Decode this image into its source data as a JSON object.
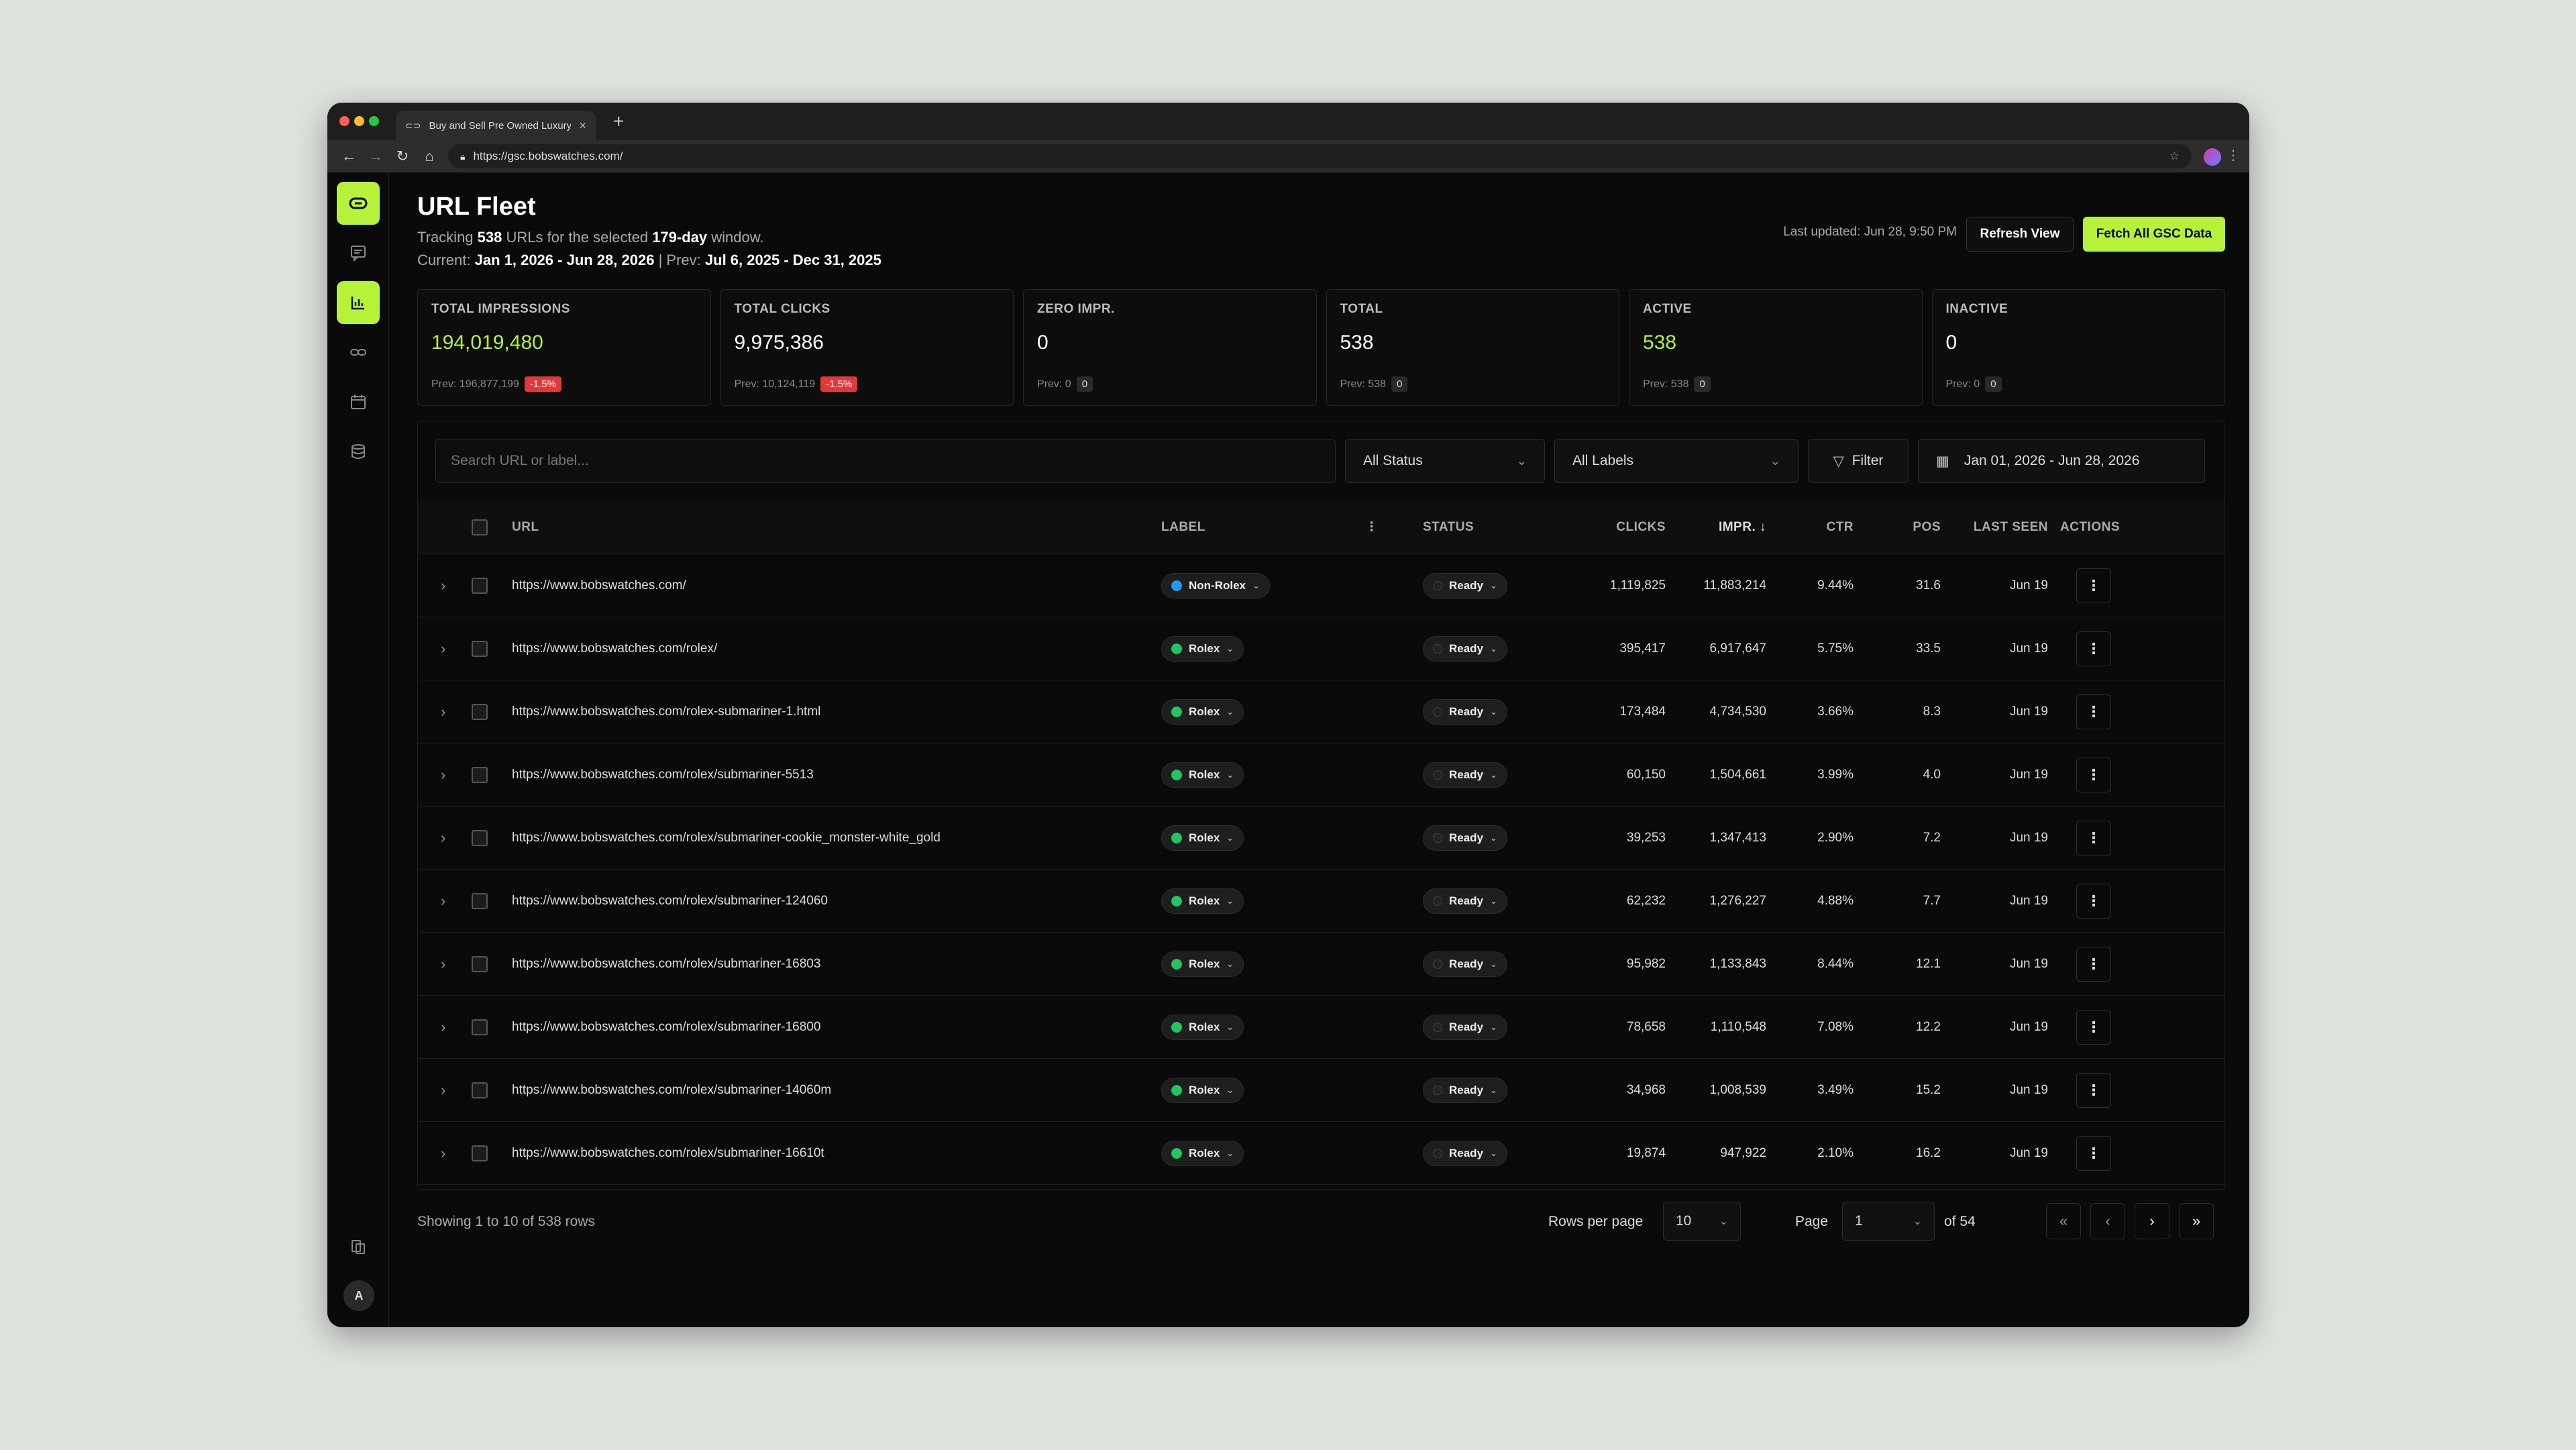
{
  "browser": {
    "tab_title": "Buy and Sell Pre Owned Luxury",
    "new_tab": "+",
    "url": "https://gsc.bobswatches.com/"
  },
  "header": {
    "title": "URL Fleet",
    "tracking_prefix": "Tracking",
    "tracking_count": "538",
    "tracking_mid": "URLs for the selected",
    "tracking_window": "179-day",
    "tracking_suffix": "window.",
    "current_label": "Current:",
    "current_range": "Jan 1, 2026 - Jun 28, 2026",
    "sep": "|",
    "prev_label": "Prev:",
    "prev_range": "Jul 6, 2025 - Dec 31, 2025",
    "last_updated": "Last updated: Jun 28, 9:50 PM",
    "refresh_label": "Refresh View",
    "fetch_label": "Fetch All GSC Data"
  },
  "stats": [
    {
      "label": "TOTAL IMPRESSIONS",
      "value": "194,019,480",
      "prev": "Prev: 196,877,199",
      "delta": "-1.5%"
    },
    {
      "label": "TOTAL CLICKS",
      "value": "9,975,386",
      "prev": "Prev: 10,124,119",
      "delta": "-1.5%"
    },
    {
      "label": "ZERO IMPR.",
      "value": "0",
      "prev": "Prev: 0",
      "delta": "0"
    },
    {
      "label": "TOTAL",
      "value": "538",
      "prev": "Prev: 538",
      "delta": "0"
    },
    {
      "label": "ACTIVE",
      "value": "538",
      "prev": "Prev: 538",
      "delta": "0"
    },
    {
      "label": "INACTIVE",
      "value": "0",
      "prev": "Prev: 0",
      "delta": "0"
    }
  ],
  "filters": {
    "search_placeholder": "Search URL or label...",
    "status": "All Status",
    "labels": "All Labels",
    "filter": "Filter",
    "date_range": "Jan 01, 2026 - Jun 28, 2026"
  },
  "columns": {
    "url": "URL",
    "label": "LABEL",
    "status": "STATUS",
    "clicks": "CLICKS",
    "impr": "IMPR. ↓",
    "ctr": "CTR",
    "pos": "POS",
    "last_seen": "LAST SEEN",
    "actions": "ACTIONS"
  },
  "rows": [
    {
      "url": "https://www.bobswatches.com/",
      "label": "Non-Rolex",
      "status": "Ready",
      "clicks": "1,119,825",
      "impr": "11,883,214",
      "ctr": "9.44%",
      "pos": "31.6",
      "last_seen": "Jun 19"
    },
    {
      "url": "https://www.bobswatches.com/rolex/",
      "label": "Rolex",
      "status": "Ready",
      "clicks": "395,417",
      "impr": "6,917,647",
      "ctr": "5.75%",
      "pos": "33.5",
      "last_seen": "Jun 19"
    },
    {
      "url": "https://www.bobswatches.com/rolex-submariner-1.html",
      "label": "Rolex",
      "status": "Ready",
      "clicks": "173,484",
      "impr": "4,734,530",
      "ctr": "3.66%",
      "pos": "8.3",
      "last_seen": "Jun 19"
    },
    {
      "url": "https://www.bobswatches.com/rolex/submariner-5513",
      "label": "Rolex",
      "status": "Ready",
      "clicks": "60,150",
      "impr": "1,504,661",
      "ctr": "3.99%",
      "pos": "4.0",
      "last_seen": "Jun 19"
    },
    {
      "url": "https://www.bobswatches.com/rolex/submariner-cookie_monster-white_gold",
      "label": "Rolex",
      "status": "Ready",
      "clicks": "39,253",
      "impr": "1,347,413",
      "ctr": "2.90%",
      "pos": "7.2",
      "last_seen": "Jun 19"
    },
    {
      "url": "https://www.bobswatches.com/rolex/submariner-124060",
      "label": "Rolex",
      "status": "Ready",
      "clicks": "62,232",
      "impr": "1,276,227",
      "ctr": "4.88%",
      "pos": "7.7",
      "last_seen": "Jun 19"
    },
    {
      "url": "https://www.bobswatches.com/rolex/submariner-16803",
      "label": "Rolex",
      "status": "Ready",
      "clicks": "95,982",
      "impr": "1,133,843",
      "ctr": "8.44%",
      "pos": "12.1",
      "last_seen": "Jun 19"
    },
    {
      "url": "https://www.bobswatches.com/rolex/submariner-16800",
      "label": "Rolex",
      "status": "Ready",
      "clicks": "78,658",
      "impr": "1,110,548",
      "ctr": "7.08%",
      "pos": "12.2",
      "last_seen": "Jun 19"
    },
    {
      "url": "https://www.bobswatches.com/rolex/submariner-14060m",
      "label": "Rolex",
      "status": "Ready",
      "clicks": "34,968",
      "impr": "1,008,539",
      "ctr": "3.49%",
      "pos": "15.2",
      "last_seen": "Jun 19"
    },
    {
      "url": "https://www.bobswatches.com/rolex/submariner-16610t",
      "label": "Rolex",
      "status": "Ready",
      "clicks": "19,874",
      "impr": "947,922",
      "ctr": "2.10%",
      "pos": "16.2",
      "last_seen": "Jun 19"
    }
  ],
  "footer": {
    "showing": "Showing 1 to 10 of 538 rows",
    "rows_per_page_label": "Rows per page",
    "rows_per_page": "10",
    "page_label": "Page",
    "page": "1",
    "of_pages": "of 54"
  },
  "colors": {
    "accent": "#b6f23a",
    "negative": "#e0383b",
    "non_rolex": "#1e9bf0",
    "rolex": "#22c55e"
  },
  "user": {
    "initial": "A"
  }
}
